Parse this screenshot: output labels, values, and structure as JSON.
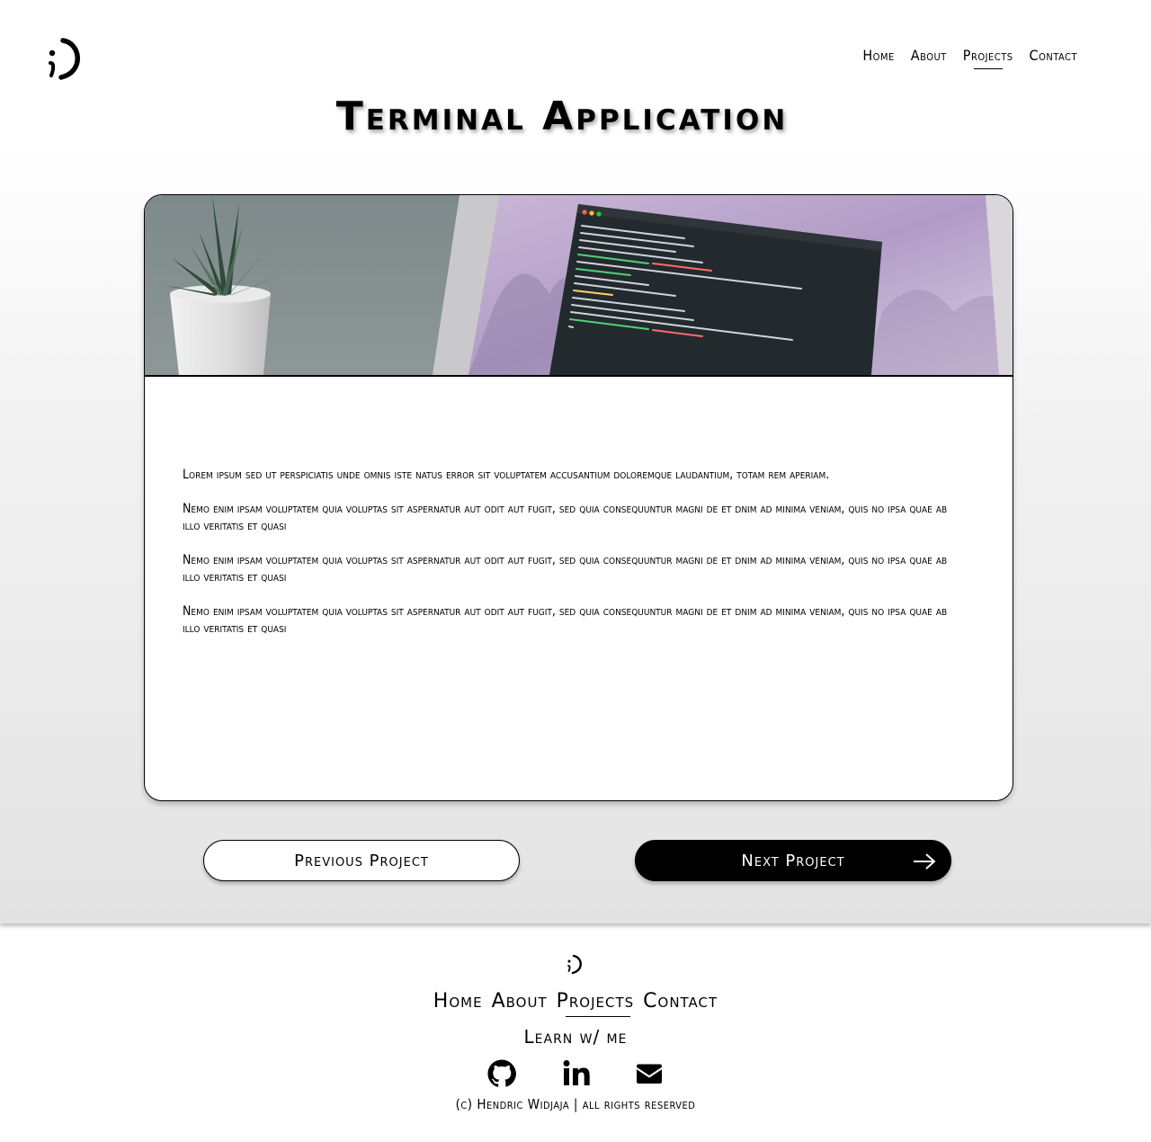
{
  "header": {
    "logo_icon": "semicolon-paren-logo-icon",
    "nav": [
      {
        "label": "Home",
        "active": false
      },
      {
        "label": "About",
        "active": false
      },
      {
        "label": "Projects",
        "active": true
      },
      {
        "label": "Contact",
        "active": false
      }
    ]
  },
  "page": {
    "title": "Terminal Application"
  },
  "card": {
    "image_icon": "laptop-terminal-plant-photo",
    "paragraphs": [
      "Lorem ipsum sed ut perspiciatis unde omnis iste natus error sit voluptatem accusantium doloremque laudantium, totam rem aperiam.",
      " Nemo enim ipsam voluptatem quia voluptas sit aspernatur aut odit aut fugit, sed quia consequuntur magni de et dnim ad minima veniam, quis no ipsa quae ab illo  veritatis et quasi",
      " Nemo enim ipsam voluptatem quia voluptas sit aspernatur aut odit aut fugit, sed quia consequuntur magni de et dnim ad minima veniam, quis no ipsa quae ab illo  veritatis et quasi",
      " Nemo enim ipsam voluptatem quia voluptas sit aspernatur aut odit aut fugit, sed quia consequuntur magni de et dnim ad minima veniam, quis no ipsa quae ab illo  veritatis et quasi"
    ]
  },
  "buttons": {
    "previous": "Previous Project",
    "next": "Next Project",
    "next_icon": "arrow-right-icon"
  },
  "footer": {
    "logo_icon": "semicolon-paren-logo-icon",
    "nav": [
      {
        "label": "Home",
        "active": false
      },
      {
        "label": "About",
        "active": false
      },
      {
        "label": "Projects",
        "active": true
      },
      {
        "label": "Contact",
        "active": false
      }
    ],
    "tagline": "Learn w/ me",
    "socials": [
      "github-icon",
      "linkedin-icon",
      "envelope-icon"
    ],
    "copyright": "(c) Hendric Widjaja | all rights reserved"
  },
  "colors": {
    "primary": "#000000",
    "background": "#ffffff",
    "gradient_bottom": "#e2e2e2"
  }
}
